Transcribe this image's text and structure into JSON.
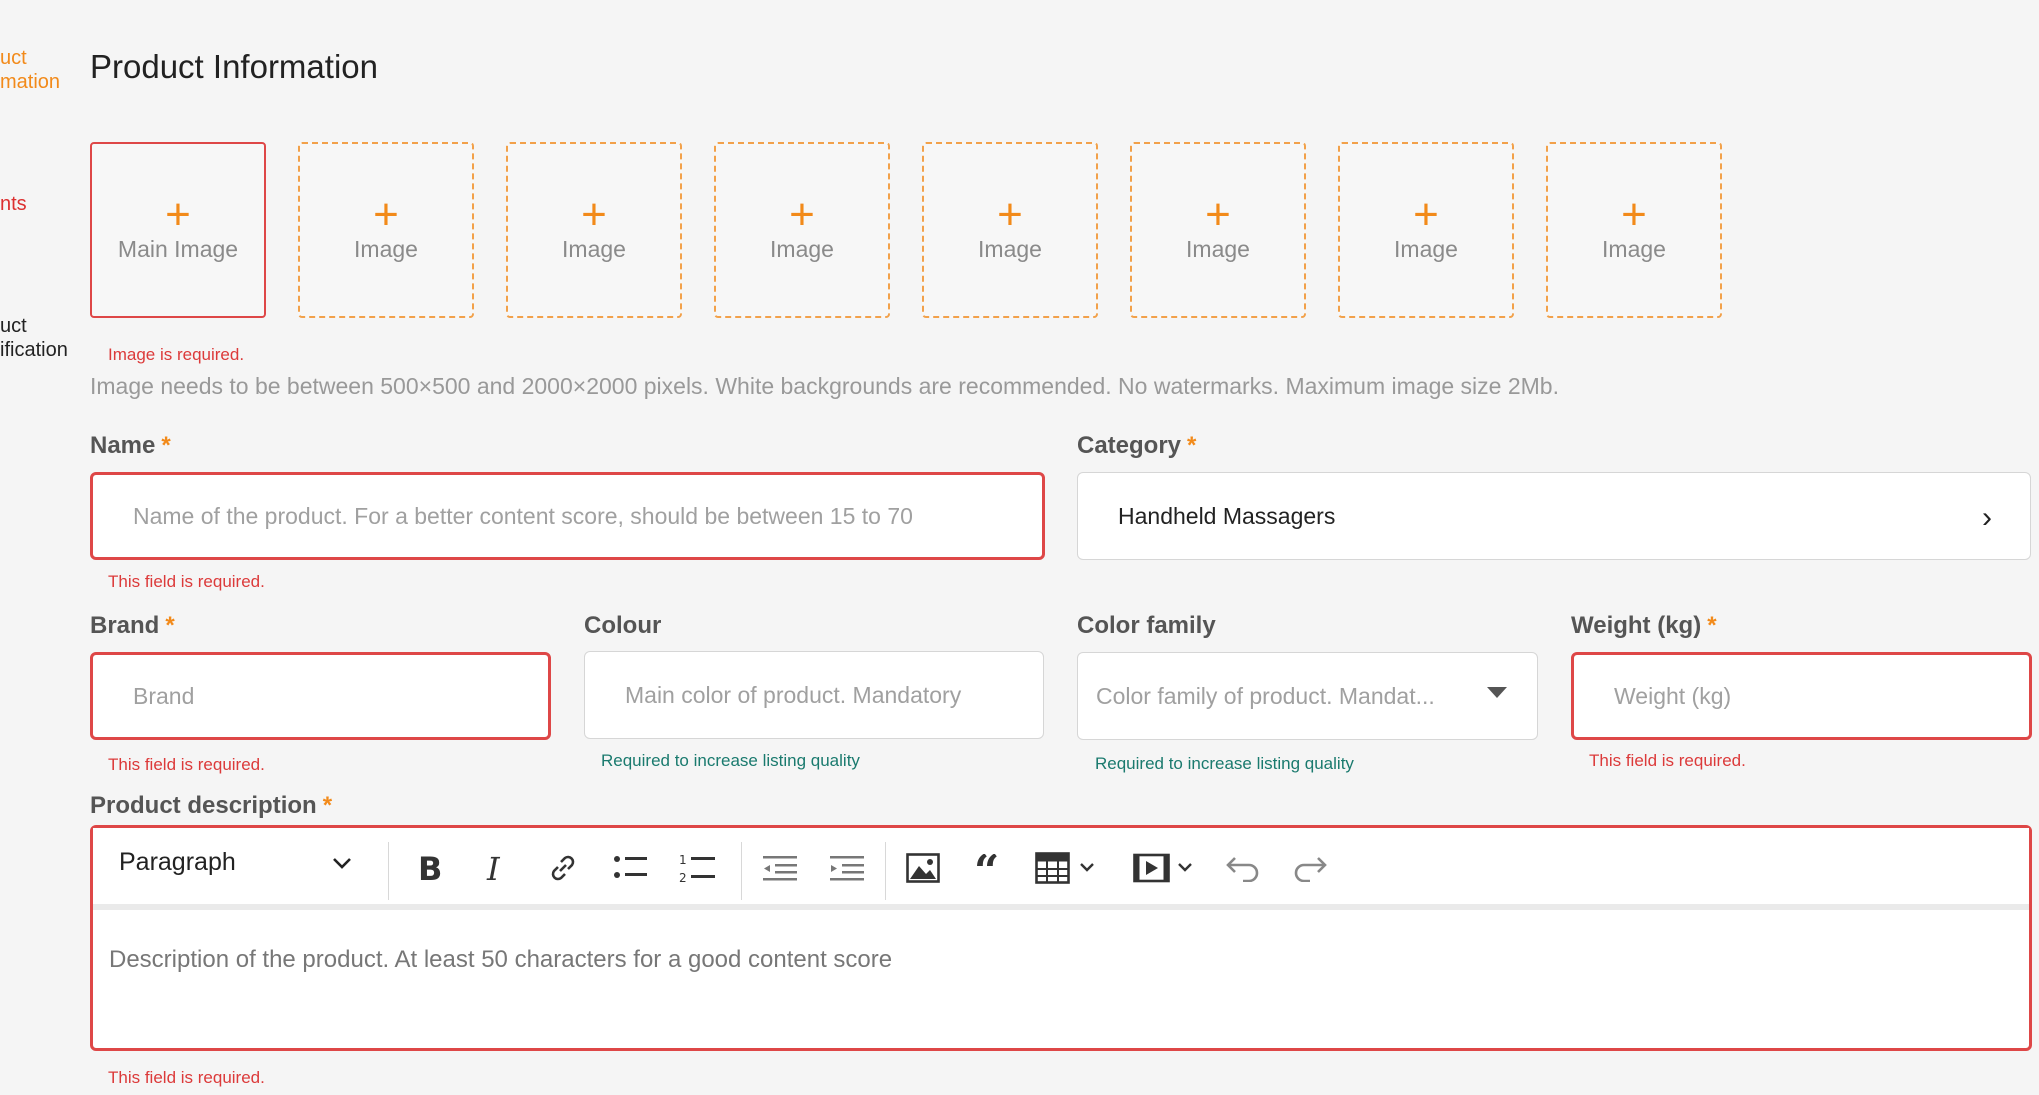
{
  "sidebar": {
    "items": [
      {
        "line1": "uct",
        "line2": "mation"
      },
      {
        "line1": "nts"
      },
      {
        "line1": "uct",
        "line2": "ification"
      }
    ]
  },
  "page": {
    "title": "Product Information"
  },
  "images": {
    "main_label": "Main Image",
    "slot_label": "Image",
    "plus": "+",
    "error": "Image is required.",
    "help": "Image needs to be between 500×500 and 2000×2000 pixels. White backgrounds are recommended. No watermarks. Maximum image size 2Mb."
  },
  "required_mark": "*",
  "name": {
    "label": "Name",
    "placeholder": "Name of the product. For a better content score, should be between 15 to 70",
    "error": "This field is required."
  },
  "category": {
    "label": "Category",
    "value": "Handheld Massagers",
    "chevron": "›"
  },
  "brand": {
    "label": "Brand",
    "placeholder": "Brand",
    "error": "This field is required."
  },
  "colour": {
    "label": "Colour",
    "placeholder": "Main color of product. Mandatory",
    "hint": "Required to increase listing quality"
  },
  "color_family": {
    "label": "Color family",
    "placeholder": "Color family of product. Mandat...",
    "hint": "Required to increase listing quality"
  },
  "weight": {
    "label": "Weight (kg)",
    "placeholder": "Weight (kg)",
    "error": "This field is required."
  },
  "description": {
    "label": "Product description",
    "paragraph": "Paragraph",
    "placeholder": "Description of the product. At least 50 characters for a good content score",
    "error": "This field is required."
  },
  "colors": {
    "accent": "#f28a1a",
    "error": "#de4747",
    "hint": "#1a7a6e"
  }
}
